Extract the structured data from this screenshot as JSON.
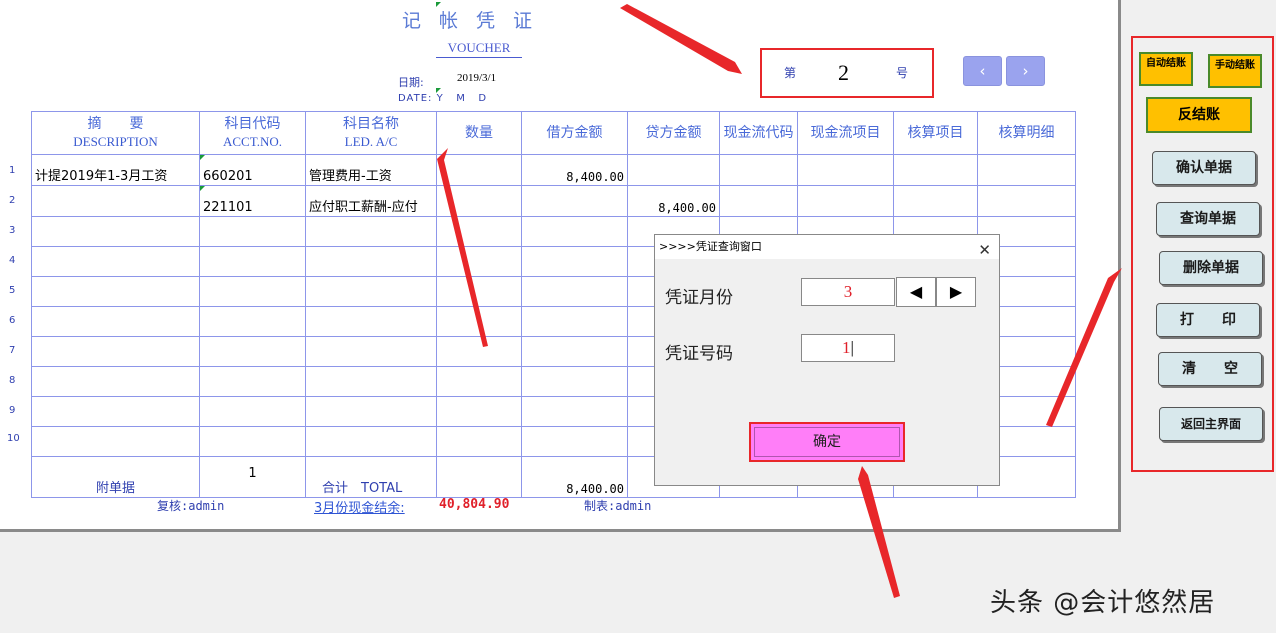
{
  "voucher": {
    "title": "记帐凭证",
    "subtitle": "VOUCHER",
    "date_label": "日期:",
    "date_value": "2019/3/1",
    "date_ymd": "DATE: Y   M   D",
    "no_prefix": "第",
    "no_value": "2",
    "no_suffix": "号",
    "prev_icon": "chevron-left-icon",
    "next_icon": "chevron-right-icon"
  },
  "table": {
    "headers": [
      {
        "cn": "摘　　要",
        "en": "DESCRIPTION"
      },
      {
        "cn": "科目代码",
        "en": "ACCT.NO."
      },
      {
        "cn": "科目名称",
        "en": "LED. A/C"
      },
      {
        "cn": "数量",
        "en": ""
      },
      {
        "cn": "借方金额",
        "en": ""
      },
      {
        "cn": "贷方金额",
        "en": ""
      },
      {
        "cn": "现金流代码",
        "en": ""
      },
      {
        "cn": "现金流项目",
        "en": ""
      },
      {
        "cn": "核算项目",
        "en": ""
      },
      {
        "cn": "核算明细",
        "en": ""
      }
    ],
    "rows": [
      {
        "num": "1",
        "desc": "计提2019年1-3月工资",
        "code": "660201",
        "name": "管理费用-工资",
        "debit": "8,400.00",
        "credit": ""
      },
      {
        "num": "2",
        "desc": "",
        "code": "221101",
        "name": "应付职工薪酬-应付",
        "debit": "",
        "credit": "8,400.00"
      },
      {
        "num": "3",
        "desc": "",
        "code": "",
        "name": "",
        "debit": "",
        "credit": ""
      },
      {
        "num": "4",
        "desc": "",
        "code": "",
        "name": "",
        "debit": "",
        "credit": ""
      },
      {
        "num": "5",
        "desc": "",
        "code": "",
        "name": "",
        "debit": "",
        "credit": ""
      },
      {
        "num": "6",
        "desc": "",
        "code": "",
        "name": "",
        "debit": "",
        "credit": ""
      },
      {
        "num": "7",
        "desc": "",
        "code": "",
        "name": "",
        "debit": "",
        "credit": ""
      },
      {
        "num": "8",
        "desc": "",
        "code": "",
        "name": "",
        "debit": "",
        "credit": ""
      },
      {
        "num": "9",
        "desc": "",
        "code": "",
        "name": "",
        "debit": "",
        "credit": ""
      },
      {
        "num": "10",
        "desc": "",
        "code": "",
        "name": "",
        "debit": "",
        "credit": ""
      }
    ],
    "total": {
      "attach_label": "附单据",
      "attach_count": "1",
      "total_label": "合计　TOTAL",
      "debit_total": "8,400.00"
    }
  },
  "footer": {
    "reviewer": "复核:admin",
    "balance_label": "3月份现金结余:",
    "balance_value": "40,804.90",
    "maker": "制表:admin"
  },
  "dialog": {
    "title": ">>>>凭证查询窗口",
    "close_icon": "close-icon",
    "month_label": "凭证月份",
    "month_value": "3",
    "month_prev": "◀",
    "month_next": "▶",
    "number_label": "凭证号码",
    "number_value": "1",
    "ok_label": "确定"
  },
  "panel": {
    "auto_close": "自动结账",
    "manual_close": "手动结账",
    "reverse_close": "反结账",
    "buttons": [
      "确认单据",
      "查询单据",
      "删除单据",
      "打　　印",
      "清　　空",
      "返回主界面"
    ]
  },
  "watermark": "头条 @会计悠然居",
  "colors": {
    "annotation": "#e8272a",
    "ok_button": "#ff7ef8",
    "gold_button": "#ffc000",
    "grid_line": "#8d96ea"
  }
}
